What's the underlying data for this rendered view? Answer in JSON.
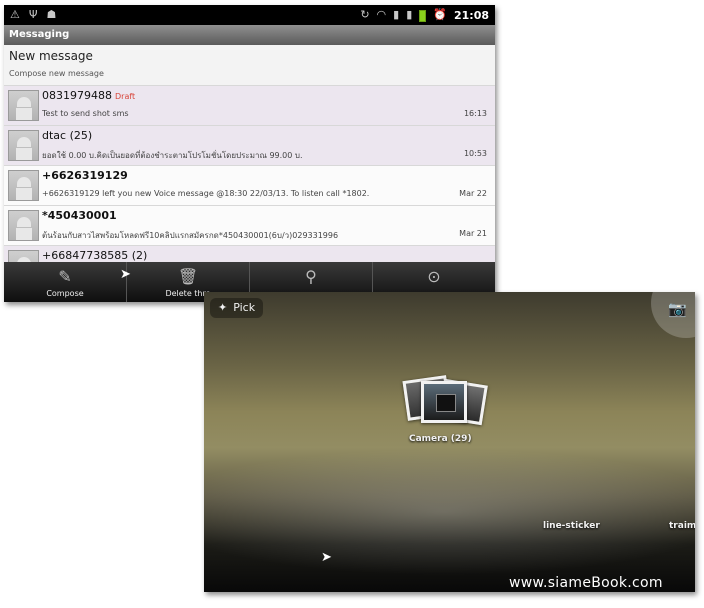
{
  "messaging": {
    "statusbar": {
      "left_icons": [
        "warning-icon",
        "usb-icon",
        "android-debug-icon"
      ],
      "right_icons": [
        "sync-icon",
        "wifi-icon",
        "signal-icon",
        "signal-icon",
        "battery-icon",
        "alarm-icon"
      ],
      "time": "21:08"
    },
    "app_title": "Messaging",
    "new_message": {
      "title": "New message",
      "subtitle": "Compose new message"
    },
    "conversations": [
      {
        "from": "0831979488",
        "draft": "Draft",
        "subject": "Test to send shot sms",
        "date": "16:13",
        "unread": false
      },
      {
        "from": "dtac (25)",
        "draft": "",
        "subject": "ยอดใช้ 0.00 บ.คิดเป็นยอดที่ต้องชำระตามโปรโมชั่นโดยประมาณ 99.00 บ.",
        "date": "10:53",
        "unread": false
      },
      {
        "from": "+6626319129",
        "draft": "",
        "subject": "+6626319129 left you new Voice message @18:30 22/03/13. To listen call *1802.",
        "date": "Mar 22",
        "unread": true
      },
      {
        "from": "*450430001",
        "draft": "",
        "subject": "ต้นร้อนกับสาวไสพร้อมโหลดฟรี10คลิปแรกสมัครกด*450430001(6บ/ว)029331996",
        "date": "Mar 21",
        "unread": true
      },
      {
        "from": "+66847738585 (2)",
        "draft": "",
        "subject": "",
        "date": "",
        "unread": false
      }
    ],
    "menu": [
      {
        "label": "Compose",
        "icon": "compose-icon",
        "glyph": "✎"
      },
      {
        "label": "Delete thre",
        "icon": "trash-icon",
        "glyph": "🗑"
      },
      {
        "label": "",
        "icon": "search-icon",
        "glyph": "⚲"
      },
      {
        "label": "",
        "icon": "settings-icon",
        "glyph": "⊙"
      }
    ]
  },
  "gallery": {
    "pick_label": "Pick",
    "albums": [
      {
        "label": "Camera  (29)"
      },
      {
        "label": "line-sticker"
      },
      {
        "label": "traim"
      }
    ]
  },
  "watermark": "www.siameBook.com"
}
